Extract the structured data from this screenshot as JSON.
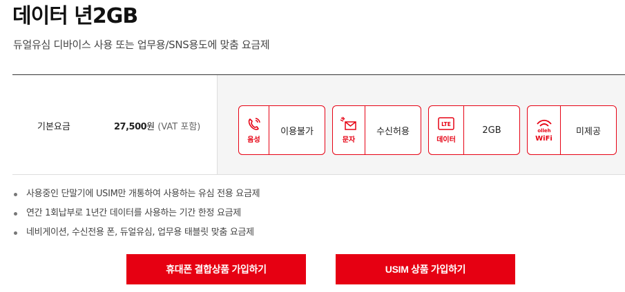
{
  "plan": {
    "title": "데이터 년2GB",
    "subtitle": "듀얼유심 디바이스 사용 또는 업무용/SNS용도에 맞춤 요금제"
  },
  "price": {
    "label": "기본요금",
    "amount": "27,500",
    "unit": "원",
    "vat": "(VAT 포함)"
  },
  "features": [
    {
      "icon": "phone-icon",
      "icon_label": "음성",
      "value": "이용불가"
    },
    {
      "icon": "message-icon",
      "icon_label": "문자",
      "value": "수신허용"
    },
    {
      "icon": "lte-icon",
      "icon_label": "데이터",
      "icon_text": "LTE",
      "value": "2GB"
    },
    {
      "icon": "wifi-icon",
      "icon_label": "WiFi",
      "icon_text": "olleh",
      "value": "미제공"
    }
  ],
  "notes": [
    "사용중인 단말기에 USIM만 개통하여 사용하는 유심 전용 요금제",
    "연간 1회납부로 1년간 데이터를 사용하는 기간 한정 요금제",
    "네비게이션, 수신전용 폰, 듀얼유심, 업무용 태블릿 맞춤 요금제"
  ],
  "buttons": {
    "phone_bundle": "휴대폰 결합상품 가입하기",
    "usim": "USIM 상품 가입하기"
  },
  "colors": {
    "accent": "#e60012"
  }
}
